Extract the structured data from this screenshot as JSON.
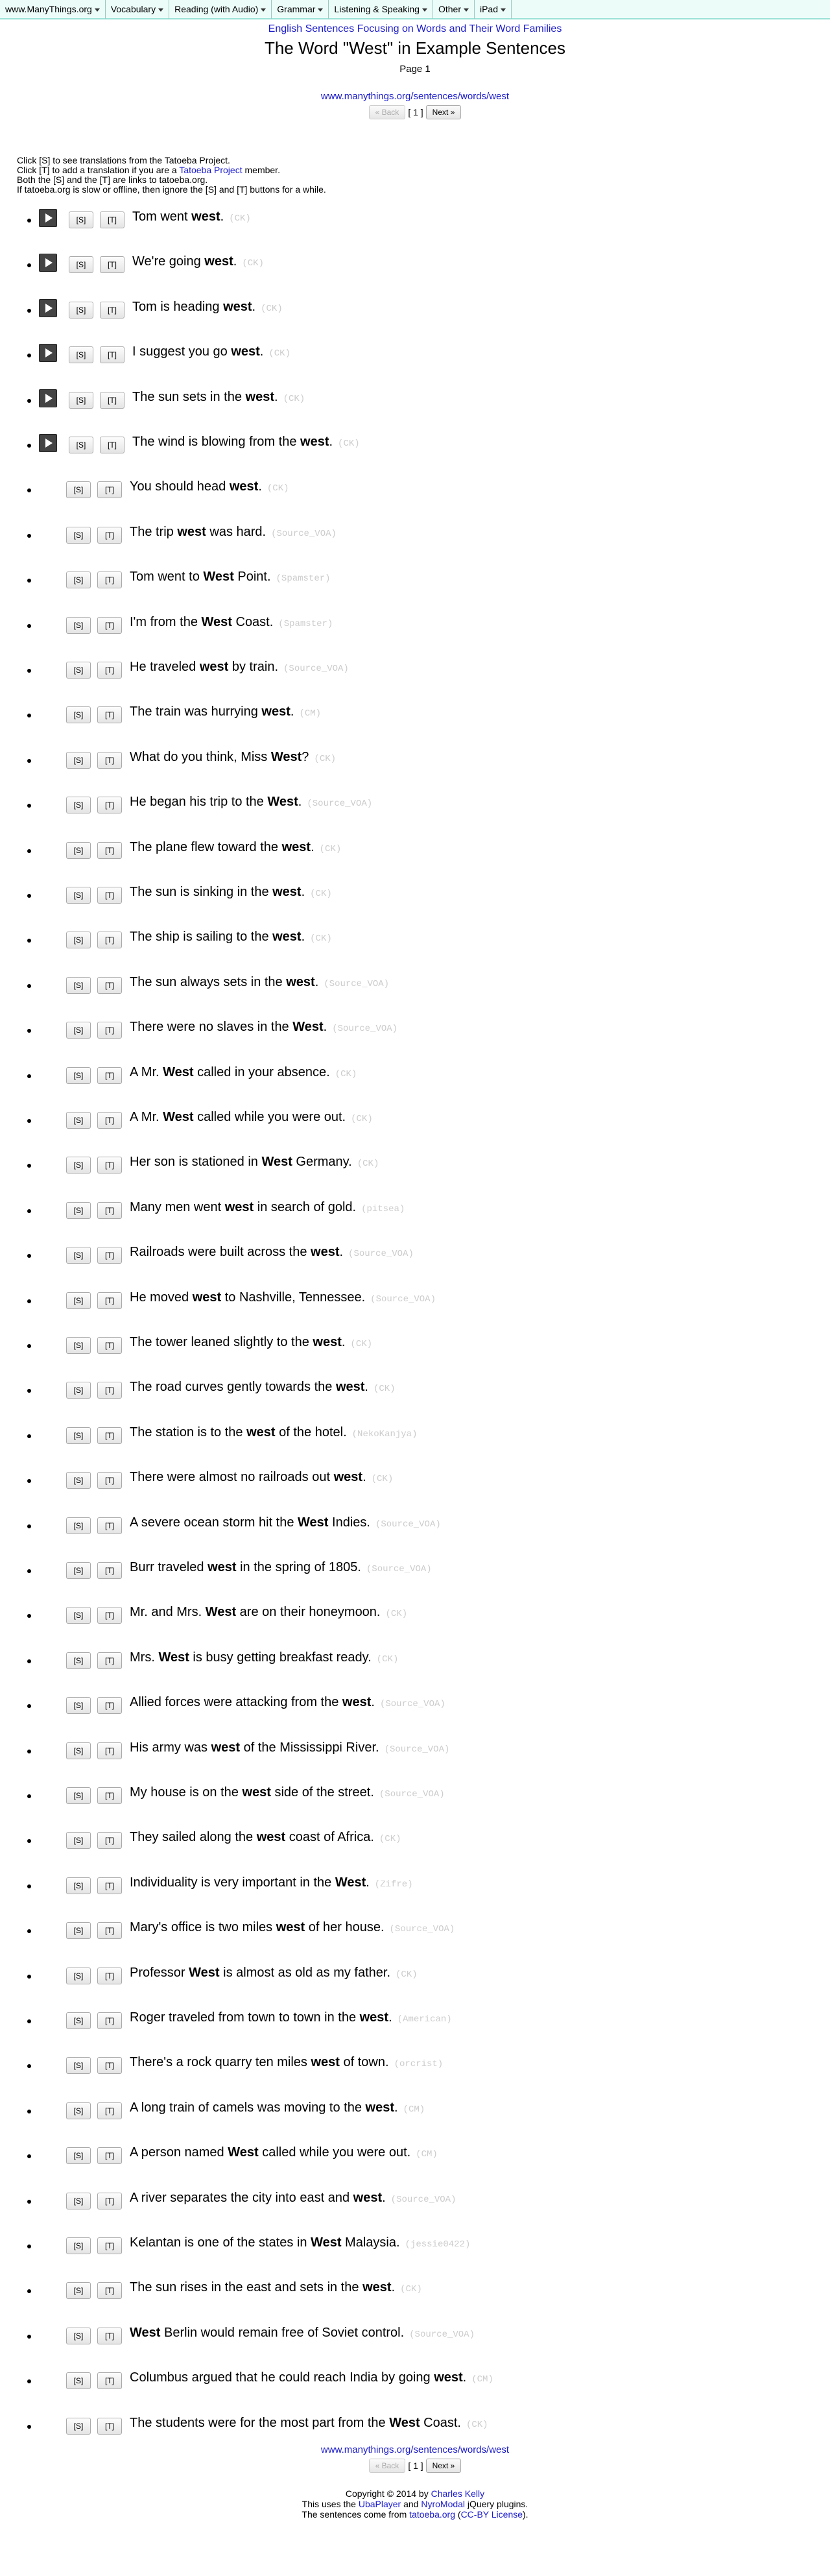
{
  "nav": {
    "items": [
      {
        "label": "www.ManyThings.org",
        "dropdown": true
      },
      {
        "label": "Vocabulary",
        "dropdown": true
      },
      {
        "label": "Reading (with Audio)",
        "dropdown": true
      },
      {
        "label": "Grammar",
        "dropdown": true
      },
      {
        "label": "Listening & Speaking",
        "dropdown": true
      },
      {
        "label": "Other",
        "dropdown": true
      },
      {
        "label": "iPad",
        "dropdown": true
      }
    ]
  },
  "header": {
    "family_link": "English Sentences Focusing on Words and Their Word Families",
    "title": "The Word \"West\" in Example Sentences",
    "page": "Page 1"
  },
  "url": "www.manythings.org/sentences/words/west",
  "pager": {
    "back": "« Back",
    "current": "[ 1 ]",
    "next": "Next »"
  },
  "instructions": {
    "line1": "Click [S] to see translations from the Tatoeba Project.",
    "line2_a": "Click [T] to add a translation if you are a ",
    "line2_link": "Tatoeba Project",
    "line2_b": " member.",
    "line3": "Both the [S] and the [T] are links to tatoeba.org.",
    "line4": "If tatoeba.org is slow or offline, then ignore the [S] and [T] buttons for a while."
  },
  "buttons": {
    "s": "[S]",
    "t": "[T]"
  },
  "sentences": [
    {
      "audio": true,
      "pre": "Tom went ",
      "word": "west",
      "post": ".",
      "contrib": "(CK)"
    },
    {
      "audio": true,
      "pre": "We're going ",
      "word": "west",
      "post": ".",
      "contrib": "(CK)"
    },
    {
      "audio": true,
      "pre": "Tom is heading ",
      "word": "west",
      "post": ".",
      "contrib": "(CK)"
    },
    {
      "audio": true,
      "pre": "I suggest you go ",
      "word": "west",
      "post": ".",
      "contrib": "(CK)"
    },
    {
      "audio": true,
      "pre": "The sun sets in the ",
      "word": "west",
      "post": ".",
      "contrib": "(CK)"
    },
    {
      "audio": true,
      "pre": "The wind is blowing from the ",
      "word": "west",
      "post": ".",
      "contrib": "(CK)"
    },
    {
      "audio": false,
      "pre": "You should head ",
      "word": "west",
      "post": ".",
      "contrib": "(CK)"
    },
    {
      "audio": false,
      "pre": "The trip ",
      "word": "west",
      "post": " was hard.",
      "contrib": "(Source_VOA)"
    },
    {
      "audio": false,
      "pre": "Tom went to ",
      "word": "West",
      "post": " Point.",
      "contrib": "(Spamster)"
    },
    {
      "audio": false,
      "pre": "I'm from the ",
      "word": "West",
      "post": " Coast.",
      "contrib": "(Spamster)"
    },
    {
      "audio": false,
      "pre": "He traveled ",
      "word": "west",
      "post": " by train.",
      "contrib": "(Source_VOA)"
    },
    {
      "audio": false,
      "pre": "The train was hurrying ",
      "word": "west",
      "post": ".",
      "contrib": "(CM)"
    },
    {
      "audio": false,
      "pre": "What do you think, Miss ",
      "word": "West",
      "post": "?",
      "contrib": "(CK)"
    },
    {
      "audio": false,
      "pre": "He began his trip to the ",
      "word": "West",
      "post": ".",
      "contrib": "(Source_VOA)"
    },
    {
      "audio": false,
      "pre": "The plane flew toward the ",
      "word": "west",
      "post": ".",
      "contrib": "(CK)"
    },
    {
      "audio": false,
      "pre": "The sun is sinking in the ",
      "word": "west",
      "post": ".",
      "contrib": "(CK)"
    },
    {
      "audio": false,
      "pre": "The ship is sailing to the ",
      "word": "west",
      "post": ".",
      "contrib": "(CK)"
    },
    {
      "audio": false,
      "pre": "The sun always sets in the ",
      "word": "west",
      "post": ".",
      "contrib": "(Source_VOA)"
    },
    {
      "audio": false,
      "pre": "There were no slaves in the ",
      "word": "West",
      "post": ".",
      "contrib": "(Source_VOA)"
    },
    {
      "audio": false,
      "pre": "A Mr. ",
      "word": "West",
      "post": " called in your absence.",
      "contrib": "(CK)"
    },
    {
      "audio": false,
      "pre": "A Mr. ",
      "word": "West",
      "post": " called while you were out.",
      "contrib": "(CK)"
    },
    {
      "audio": false,
      "pre": "Her son is stationed in ",
      "word": "West",
      "post": " Germany.",
      "contrib": "(CK)"
    },
    {
      "audio": false,
      "pre": "Many men went ",
      "word": "west",
      "post": " in search of gold.",
      "contrib": "(pitsea)"
    },
    {
      "audio": false,
      "pre": "Railroads were built across the ",
      "word": "west",
      "post": ".",
      "contrib": "(Source_VOA)"
    },
    {
      "audio": false,
      "pre": "He moved ",
      "word": "west",
      "post": " to Nashville, Tennessee.",
      "contrib": "(Source_VOA)"
    },
    {
      "audio": false,
      "pre": "The tower leaned slightly to the ",
      "word": "west",
      "post": ".",
      "contrib": "(CK)"
    },
    {
      "audio": false,
      "pre": "The road curves gently towards the ",
      "word": "west",
      "post": ".",
      "contrib": "(CK)"
    },
    {
      "audio": false,
      "pre": "The station is to the ",
      "word": "west",
      "post": " of the hotel.",
      "contrib": "(NekoKanjya)"
    },
    {
      "audio": false,
      "pre": "There were almost no railroads out ",
      "word": "west",
      "post": ".",
      "contrib": "(CK)"
    },
    {
      "audio": false,
      "pre": "A severe ocean storm hit the ",
      "word": "West",
      "post": " Indies.",
      "contrib": "(Source_VOA)"
    },
    {
      "audio": false,
      "pre": "Burr traveled ",
      "word": "west",
      "post": " in the spring of 1805.",
      "contrib": "(Source_VOA)"
    },
    {
      "audio": false,
      "pre": "Mr. and Mrs. ",
      "word": "West",
      "post": " are on their honeymoon.",
      "contrib": "(CK)"
    },
    {
      "audio": false,
      "pre": "Mrs. ",
      "word": "West",
      "post": " is busy getting breakfast ready.",
      "contrib": "(CK)"
    },
    {
      "audio": false,
      "pre": "Allied forces were attacking from the ",
      "word": "west",
      "post": ".",
      "contrib": "(Source_VOA)"
    },
    {
      "audio": false,
      "pre": "His army was ",
      "word": "west",
      "post": " of the Mississippi River.",
      "contrib": "(Source_VOA)"
    },
    {
      "audio": false,
      "pre": "My house is on the ",
      "word": "west",
      "post": " side of the street.",
      "contrib": "(Source_VOA)"
    },
    {
      "audio": false,
      "pre": "They sailed along the ",
      "word": "west",
      "post": " coast of Africa.",
      "contrib": "(CK)"
    },
    {
      "audio": false,
      "pre": "Individuality is very important in the ",
      "word": "West",
      "post": ".",
      "contrib": "(Zifre)"
    },
    {
      "audio": false,
      "pre": "Mary's office is two miles ",
      "word": "west",
      "post": " of her house.",
      "contrib": "(Source_VOA)"
    },
    {
      "audio": false,
      "pre": "Professor ",
      "word": "West",
      "post": " is almost as old as my father.",
      "contrib": "(CK)"
    },
    {
      "audio": false,
      "pre": "Roger traveled from town to town in the ",
      "word": "west",
      "post": ".",
      "contrib": "(American)"
    },
    {
      "audio": false,
      "pre": "There's a rock quarry ten miles ",
      "word": "west",
      "post": " of town.",
      "contrib": "(orcrist)"
    },
    {
      "audio": false,
      "pre": "A long train of camels was moving to the ",
      "word": "west",
      "post": ".",
      "contrib": "(CM)"
    },
    {
      "audio": false,
      "pre": "A person named ",
      "word": "West",
      "post": " called while you were out.",
      "contrib": "(CM)"
    },
    {
      "audio": false,
      "pre": "A river separates the city into east and ",
      "word": "west",
      "post": ".",
      "contrib": "(Source_VOA)"
    },
    {
      "audio": false,
      "pre": "Kelantan is one of the states in ",
      "word": "West",
      "post": " Malaysia.",
      "contrib": "(jessie0422)"
    },
    {
      "audio": false,
      "pre": "The sun rises in the east and sets in the ",
      "word": "west",
      "post": ".",
      "contrib": "(CK)"
    },
    {
      "audio": false,
      "pre": "",
      "word": "West",
      "post": " Berlin would remain free of Soviet control.",
      "contrib": "(Source_VOA)"
    },
    {
      "audio": false,
      "pre": "Columbus argued that he could reach India by going ",
      "word": "west",
      "post": ".",
      "contrib": "(CM)"
    },
    {
      "audio": false,
      "pre": "The students were for the most part from the ",
      "word": "West",
      "post": " Coast.",
      "contrib": "(CK)"
    }
  ],
  "footer": {
    "copyright_pre": "Copyright © 2014 by ",
    "author": "Charles Kelly",
    "uses_pre": "This uses the ",
    "uba": "UbaPlayer",
    "uses_and": " and ",
    "nyro": "NyroModal",
    "uses_post": " jQuery plugins.",
    "source_pre": "The sentences come from ",
    "tatoeba": "tatoeba.org",
    "source_mid": " (",
    "license": "CC-BY License",
    "source_post": ")."
  }
}
